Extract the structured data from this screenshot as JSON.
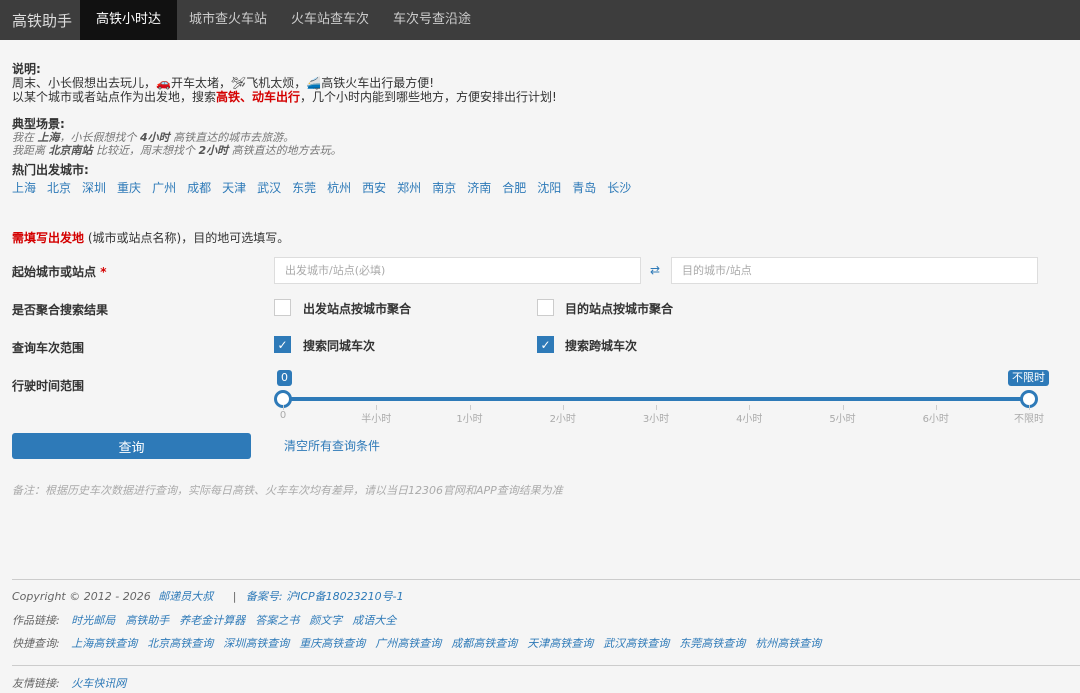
{
  "nav": {
    "brand": "高铁助手",
    "items": [
      {
        "label": "高铁小时达"
      },
      {
        "label": "城市查火车站"
      },
      {
        "label": "火车站查车次"
      },
      {
        "label": "车次号查沿途"
      }
    ]
  },
  "intro": {
    "title": "说明:",
    "line1_a": "周末、小长假想出去玩儿，",
    "line1_b": "开车太堵，",
    "line1_c": "飞机太烦，",
    "line1_d": "高铁火车出行最方便!",
    "line2_a": "以某个城市或者站点作为出发地，搜索",
    "line2_red": "高铁、动车出行",
    "line2_b": "，几个小时内能到哪些地方，方便安排出行计划!"
  },
  "scene": {
    "title": "典型场景:",
    "ex1_a": "我在",
    "ex1_b": "上海",
    "ex1_c": "，小长假想找个",
    "ex1_d": "4小时",
    "ex1_e": "高铁直达的城市去旅游。",
    "ex2_a": "我距离",
    "ex2_b": "北京南站",
    "ex2_c": "比较近，周末想找个",
    "ex2_d": "2小时",
    "ex2_e": "高铁直达的地方去玩。"
  },
  "hot": {
    "title": "热门出发城市:",
    "cities": [
      "上海",
      "北京",
      "深圳",
      "重庆",
      "广州",
      "成都",
      "天津",
      "武汉",
      "东莞",
      "杭州",
      "西安",
      "郑州",
      "南京",
      "济南",
      "合肥",
      "沈阳",
      "青岛",
      "长沙"
    ]
  },
  "form": {
    "notice_red": "需填写出发地",
    "notice_rest": "(城市或站点名称)，目的地可选填写。",
    "origin_label": "起始城市或站点",
    "required_mark": "*",
    "origin_placeholder": "出发城市/站点(必填)",
    "dest_placeholder": "目的城市/站点",
    "swap_icon": "⇄",
    "merge_label": "是否聚合搜索结果",
    "merge_origin": "出发站点按城市聚合",
    "merge_dest": "目的站点按城市聚合",
    "scope_label": "查询车次范围",
    "scope_same": "搜索同城车次",
    "scope_cross": "搜索跨城车次",
    "time_label": "行驶时间范围",
    "slider_min_tip": "0",
    "slider_max_tip": "不限时",
    "ticks": [
      "0",
      "半小时",
      "1小时",
      "2小时",
      "3小时",
      "4小时",
      "5小时",
      "6小时",
      "不限时"
    ],
    "search_button": "查询",
    "clear_link": "清空所有查询条件",
    "remark": "备注：根据历史车次数据进行查询，实际每日高铁、火车车次均有差异，请以当日12306官网和APP查询结果为准"
  },
  "footer": {
    "copyright": "Copyright © 2012 - 2026",
    "author": "邮递员大叔",
    "sep": "|",
    "icp": "备案号: 沪ICP备18023210号-1",
    "works_label": "作品链接:",
    "works": [
      "时光邮局",
      "高铁助手",
      "养老金计算器",
      "答案之书",
      "颜文字",
      "成语大全"
    ],
    "quick_label": "快捷查询:",
    "quick": [
      "上海高铁查询",
      "北京高铁查询",
      "深圳高铁查询",
      "重庆高铁查询",
      "广州高铁查询",
      "成都高铁查询",
      "天津高铁查询",
      "武汉高铁查询",
      "东莞高铁查询",
      "杭州高铁查询"
    ],
    "friend_label": "友情链接:",
    "friends": [
      "火车快讯网"
    ]
  },
  "colors": {
    "accent": "#2e7ab8",
    "red": "#d40000",
    "nav_bg": "#3d3d3d"
  }
}
